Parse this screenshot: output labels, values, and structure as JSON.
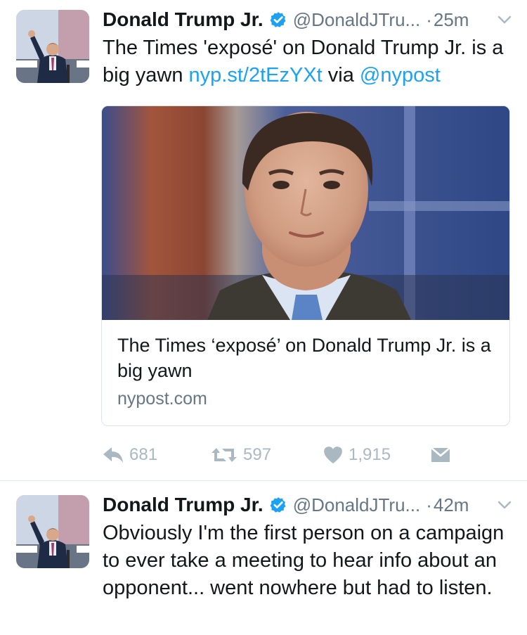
{
  "tweets": [
    {
      "name": "Donald Trump Jr.",
      "handle": "@DonaldJTru...",
      "dot": "·",
      "time": "25m",
      "text_parts": [
        "The Times 'exposé' on Donald Trump Jr. is a big yawn ",
        "nyp.st/2tEzYXt",
        " via ",
        "@nypost"
      ],
      "card": {
        "title": "The Times ‘exposé’ on Donald Trump Jr. is a big yawn",
        "domain": "nypost.com"
      },
      "actions": {
        "replies": "681",
        "retweets": "597",
        "likes": "1,915"
      }
    },
    {
      "name": "Donald Trump Jr.",
      "handle": "@DonaldJTru...",
      "dot": "·",
      "time": "42m",
      "text": "Obviously I'm the first person on a campaign to ever take a meeting to hear info about an opponent... went nowhere but had to listen."
    }
  ],
  "colors": {
    "link": "#1da1f2",
    "verified": "#1da1f2",
    "secondary_text": "#657786",
    "action_icon": "#aab8c2"
  },
  "icons": [
    "verified-badge-icon",
    "caret-down-icon",
    "reply-icon",
    "retweet-icon",
    "heart-icon",
    "direct-message-icon"
  ]
}
